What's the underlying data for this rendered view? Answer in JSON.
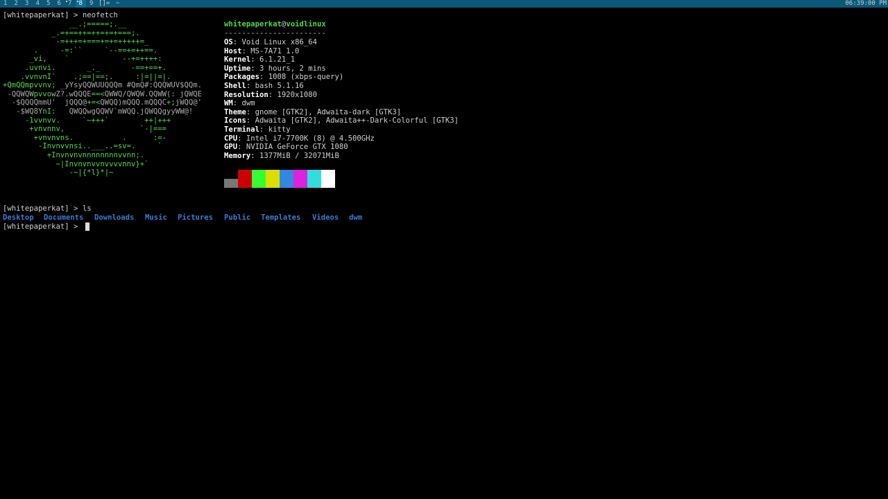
{
  "bar": {
    "tags": [
      {
        "label": "1",
        "occupied": false,
        "selected": false
      },
      {
        "label": "2",
        "occupied": false,
        "selected": false
      },
      {
        "label": "3",
        "occupied": false,
        "selected": false
      },
      {
        "label": "4",
        "occupied": false,
        "selected": false
      },
      {
        "label": "5",
        "occupied": false,
        "selected": false
      },
      {
        "label": "6",
        "occupied": false,
        "selected": false
      },
      {
        "label": "7",
        "occupied": true,
        "selected": false
      },
      {
        "label": "8",
        "occupied": true,
        "selected": true
      },
      {
        "label": "9",
        "occupied": false,
        "selected": false
      }
    ],
    "layout_symbol": "[]=",
    "window_title": "~",
    "clock": "06:39:00 PM",
    "colors": {
      "bar_bg": "#0b5878",
      "selected_tag_bg": "#0e6f96"
    }
  },
  "terminal": {
    "prompt": "[whitepaperkat] > ",
    "cmd1": "neofetch",
    "cmd2": "ls",
    "ascii_art": [
      [
        {
          "t": "               __.;=====;.__",
          "c": "grn"
        }
      ],
      [
        {
          "t": "           _.=+==++=++=+=+===;.",
          "c": "grn"
        }
      ],
      [
        {
          "t": "            -=+++=+===+=+=+++++=_",
          "c": "grn"
        }
      ],
      [
        {
          "t": "       .     -=:``     `--==+=++==.",
          "c": "grn"
        }
      ],
      [
        {
          "t": "      _vi,    `            --+=++++:",
          "c": "grn"
        }
      ],
      [
        {
          "t": "     .uvnvi.       _._       -==+==+.",
          "c": "grn"
        }
      ],
      [
        {
          "t": "    .vvnvnI`    .;==|==;.     :|=||=|.",
          "c": "grn"
        }
      ],
      [
        {
          "t": "+QmQQm",
          "c": "grn"
        },
        {
          "t": "pvvnv; ",
          "c": "grn"
        },
        {
          "t": "_yYsyQQWUUQQQm #QmQ#:QQQWUV$QQm.",
          "c": "grey"
        }
      ],
      [
        {
          "t": " -QQWQW",
          "c": "grey"
        },
        {
          "t": "pvvo",
          "c": "grn"
        },
        {
          "t": "wZ?.wQQQE",
          "c": "grey"
        },
        {
          "t": "==<",
          "c": "grn"
        },
        {
          "t": "QWWQ/QWQW.QQWW(: jQWQE",
          "c": "grey"
        }
      ],
      [
        {
          "t": "  -$QQQQmmU'  jQQQ@",
          "c": "grey"
        },
        {
          "t": "+=<",
          "c": "grn"
        },
        {
          "t": "QWQQ)mQQQ.mQQQC",
          "c": "grey"
        },
        {
          "t": "+;",
          "c": "grn"
        },
        {
          "t": "jWQQ@'",
          "c": "grey"
        }
      ],
      [
        {
          "t": "   -$WQ8Y",
          "c": "grey"
        },
        {
          "t": "nI:",
          "c": "grn"
        },
        {
          "t": "   QWQQwgQQWV`mWQQ.jQWQQgyyWW@!",
          "c": "grey"
        }
      ],
      [
        {
          "t": "     -1vvnvv.     `~+++`        ++|+++",
          "c": "grn"
        }
      ],
      [
        {
          "t": "      +vnvnnv,                 `-|===",
          "c": "grn"
        }
      ],
      [
        {
          "t": "       +vnvnvns.           .      :=-",
          "c": "grn"
        }
      ],
      [
        {
          "t": "        -Invnvvnsi..___..=sv=.     `",
          "c": "grn"
        }
      ],
      [
        {
          "t": "          +Invnvnvnnnnnnnnvvnn;.",
          "c": "grn"
        }
      ],
      [
        {
          "t": "            ~|Invnvnvvnvvvvnnv}+`",
          "c": "grn"
        }
      ],
      [
        {
          "t": "               -~|{*l}*|~",
          "c": "grn"
        }
      ]
    ],
    "info_title_user": "whitepaperkat",
    "info_title_at": "@",
    "info_title_host": "voidlinux",
    "info_separator": "-----------------------",
    "info": [
      {
        "key": "OS",
        "value": "Void Linux x86_64"
      },
      {
        "key": "Host",
        "value": "MS-7A71 1.0"
      },
      {
        "key": "Kernel",
        "value": "6.1.21_1"
      },
      {
        "key": "Uptime",
        "value": "3 hours, 2 mins"
      },
      {
        "key": "Packages",
        "value": "1008 (xbps-query)"
      },
      {
        "key": "Shell",
        "value": "bash 5.1.16"
      },
      {
        "key": "Resolution",
        "value": "1920x1080"
      },
      {
        "key": "WM",
        "value": "dwm"
      },
      {
        "key": "Theme",
        "value": "gnome [GTK2], Adwaita-dark [GTK3]"
      },
      {
        "key": "Icons",
        "value": "Adwaita [GTK2], Adwaita++-Dark-Colorful [GTK3]"
      },
      {
        "key": "Terminal",
        "value": "kitty"
      },
      {
        "key": "CPU",
        "value": "Intel i7-7700K (8) @ 4.500GHz"
      },
      {
        "key": "GPU",
        "value": "NVIDIA GeForce GTX 1080"
      },
      {
        "key": "Memory",
        "value": "1377MiB / 32071MiB"
      }
    ],
    "palette_top": [
      "#000000",
      "#cc0000",
      "#33ff33",
      "#dddd00",
      "#3388dd",
      "#dd22dd",
      "#33dddd",
      "#ffffff"
    ],
    "palette_bottom": [
      "#777777",
      "#cc0000",
      "#33ff33",
      "#dddd00",
      "#3388dd",
      "#dd22dd",
      "#33dddd",
      "#ffffff"
    ],
    "ls_output": [
      "Desktop",
      "Documents",
      "Downloads",
      "Music",
      "Pictures",
      "Public",
      "Templates",
      "Videos",
      "dwm"
    ]
  }
}
